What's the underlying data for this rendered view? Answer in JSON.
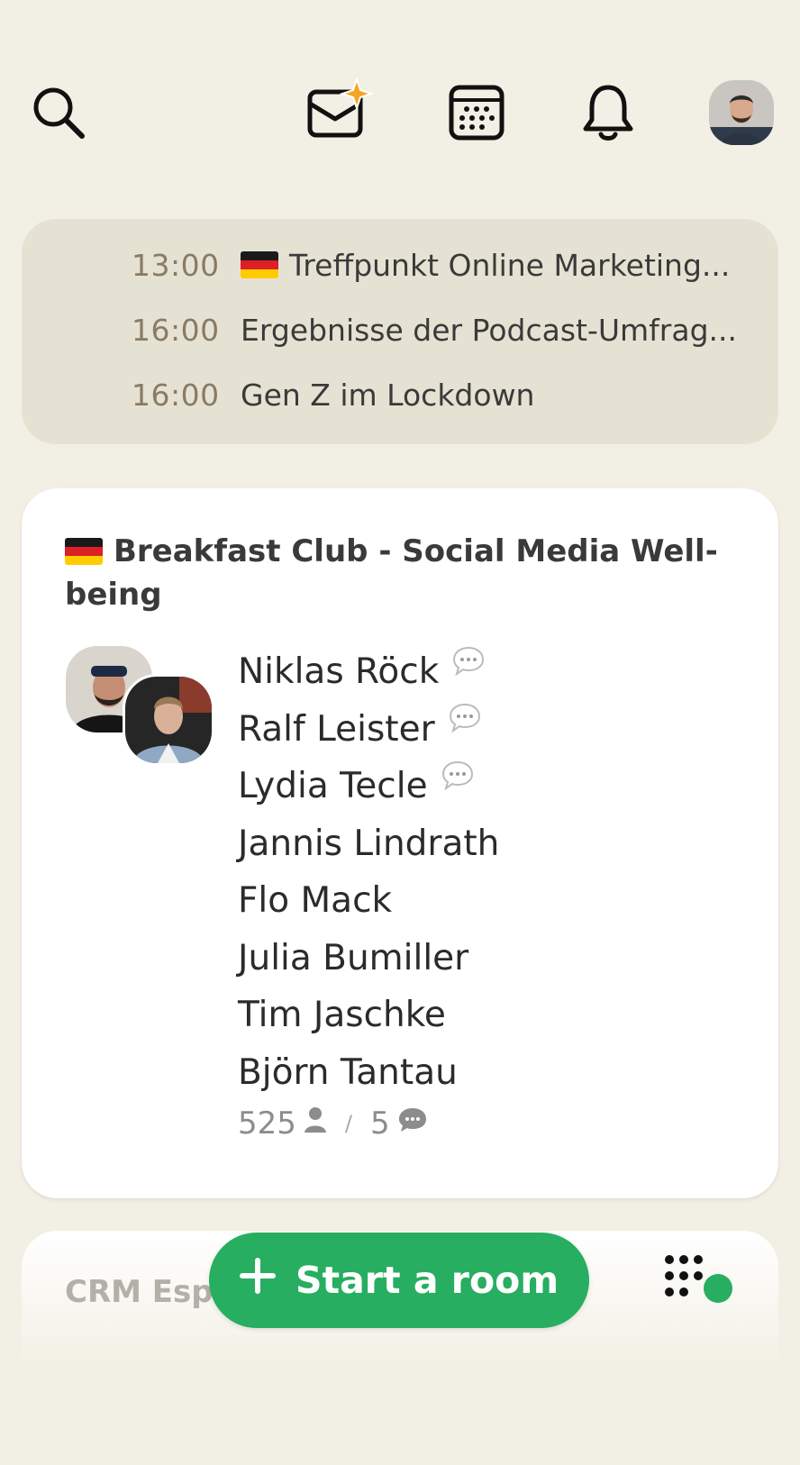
{
  "topbar": {
    "icons": [
      "search-icon",
      "invite-envelope-icon",
      "calendar-icon",
      "bell-icon"
    ]
  },
  "upcoming": [
    {
      "time": "13:00",
      "title": "Treffpunkt Online Marketing...",
      "flag": true
    },
    {
      "time": "16:00",
      "title": "Ergebnisse der Podcast-Umfrag...",
      "flag": false
    },
    {
      "time": "16:00",
      "title": "Gen Z im Lockdown",
      "flag": false
    }
  ],
  "room": {
    "title": "Breakfast Club - Social Media Well-being",
    "speakers": [
      {
        "name": "Niklas Röck",
        "speaking": true
      },
      {
        "name": "Ralf Leister",
        "speaking": true
      },
      {
        "name": "Lydia Tecle",
        "speaking": true
      },
      {
        "name": "Jannis Lindrath",
        "speaking": false
      },
      {
        "name": "Flo Mack",
        "speaking": false
      },
      {
        "name": "Julia Bumiller",
        "speaking": false
      },
      {
        "name": "Tim Jaschke",
        "speaking": false
      },
      {
        "name": "Björn Tantau",
        "speaking": false
      }
    ],
    "listeners": "525",
    "separator": "/",
    "speakers_count": "5"
  },
  "next_room": {
    "title": "CRM Esp"
  },
  "fab": {
    "label": "Start a room",
    "color": "#27ae60"
  },
  "colors": {
    "background": "#f2efe4",
    "upcoming_bg": "#e6e2d3",
    "time": "#8a7b63",
    "online_dot": "#27ae60"
  }
}
